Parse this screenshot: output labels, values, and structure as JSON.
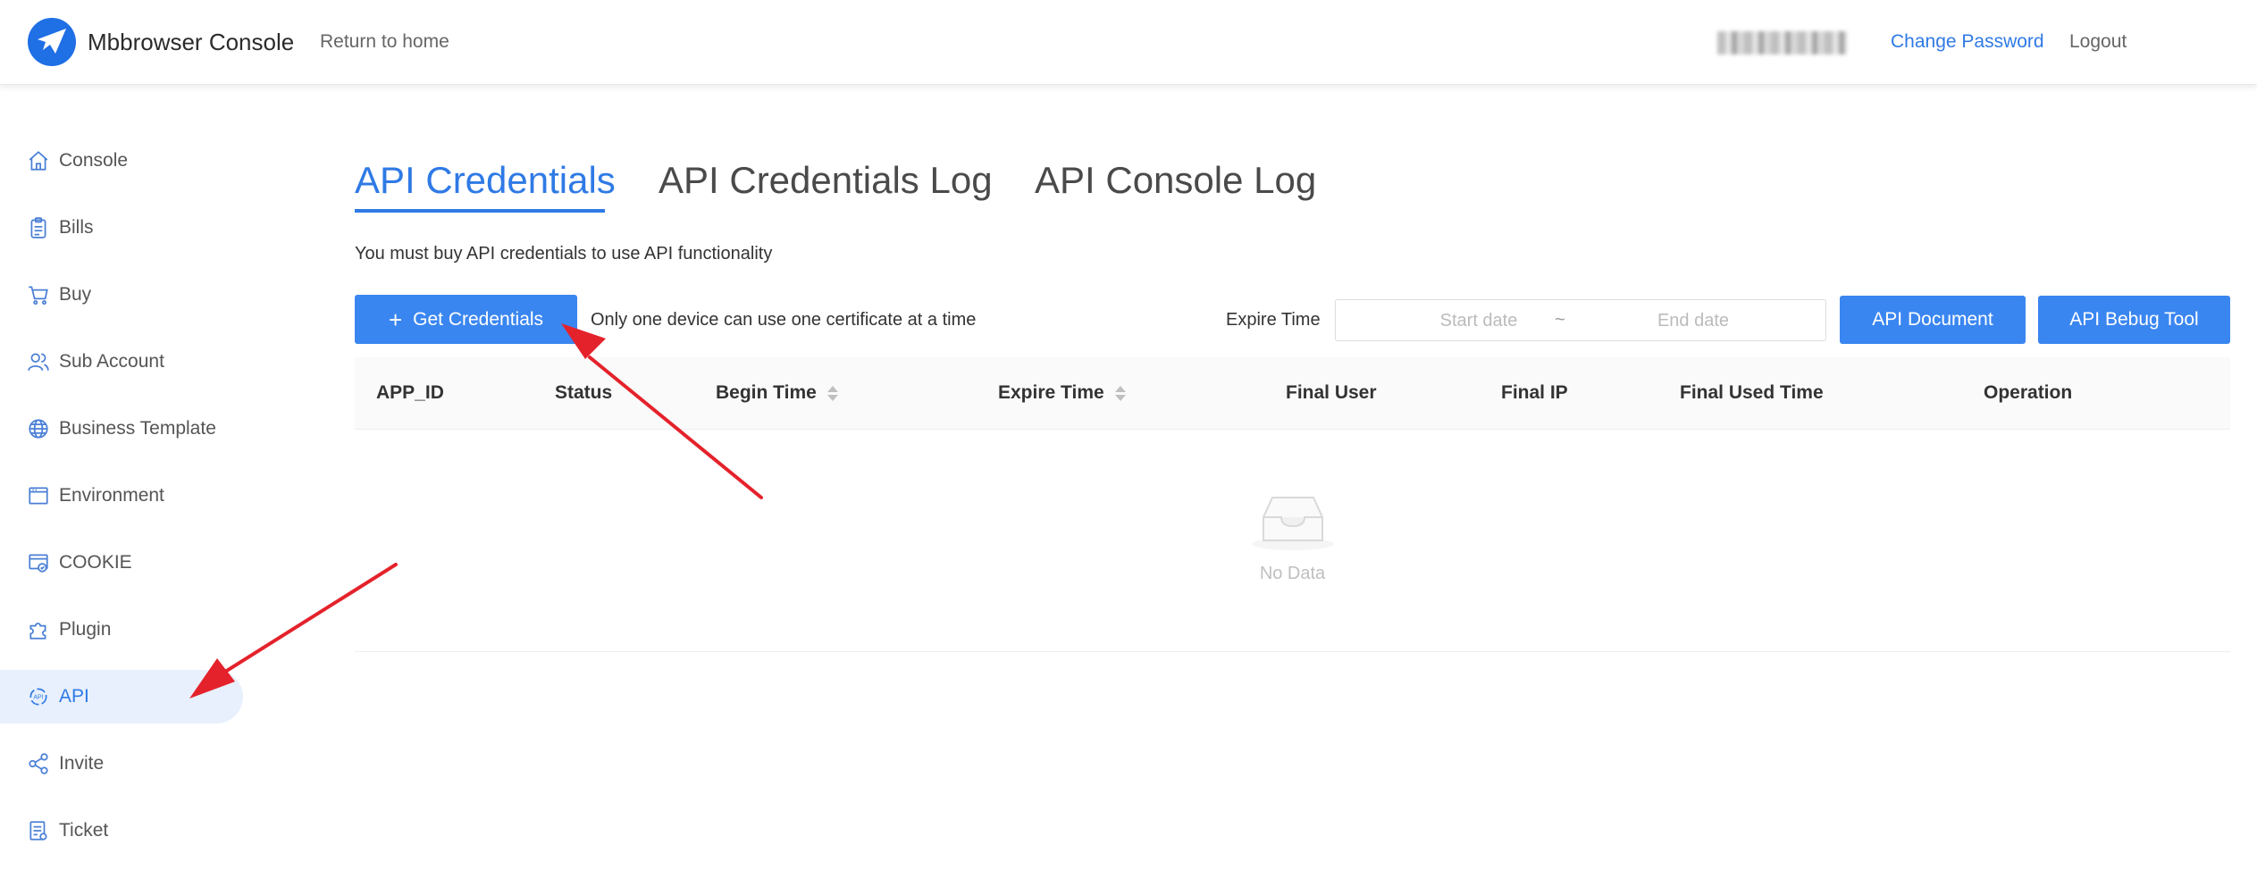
{
  "header": {
    "brand": "Mbbrowser Console",
    "home_link": "Return to home",
    "change_password": "Change Password",
    "logout": "Logout"
  },
  "sidebar": {
    "items": [
      {
        "label": "Console",
        "icon": "home-icon"
      },
      {
        "label": "Bills",
        "icon": "clipboard-icon"
      },
      {
        "label": "Buy",
        "icon": "cart-icon"
      },
      {
        "label": "Sub Account",
        "icon": "users-icon"
      },
      {
        "label": "Business Template",
        "icon": "globe-icon"
      },
      {
        "label": "Environment",
        "icon": "window-icon"
      },
      {
        "label": "COOKIE",
        "icon": "cookie-card-icon"
      },
      {
        "label": "Plugin",
        "icon": "puzzle-icon"
      },
      {
        "label": "API",
        "icon": "api-icon",
        "active": true
      },
      {
        "label": "Invite",
        "icon": "share-icon"
      },
      {
        "label": "Ticket",
        "icon": "ticket-icon"
      }
    ]
  },
  "tabs": [
    {
      "label": "API Credentials",
      "active": true
    },
    {
      "label": "API Credentials Log"
    },
    {
      "label": "API Console Log"
    }
  ],
  "notice": "You must buy API credentials to use API functionality",
  "toolbar": {
    "get_credentials": "Get Credentials",
    "one_device_note": "Only one device can use one certificate at a time",
    "expire_label": "Expire Time",
    "start_placeholder": "Start date",
    "range_separator": "~",
    "end_placeholder": "End date",
    "api_document": "API Document",
    "api_tool": "API Bebug Tool"
  },
  "table": {
    "columns": [
      "APP_ID",
      "Status",
      "Begin Time",
      "Expire Time",
      "Final User",
      "Final IP",
      "Final Used Time",
      "Operation"
    ],
    "rows": [],
    "empty_text": "No Data"
  },
  "colors": {
    "accent": "#2f7ae5",
    "button": "#3a86f1",
    "active_bg": "#e8f0fd",
    "annotation_arrow": "#e4222b"
  }
}
